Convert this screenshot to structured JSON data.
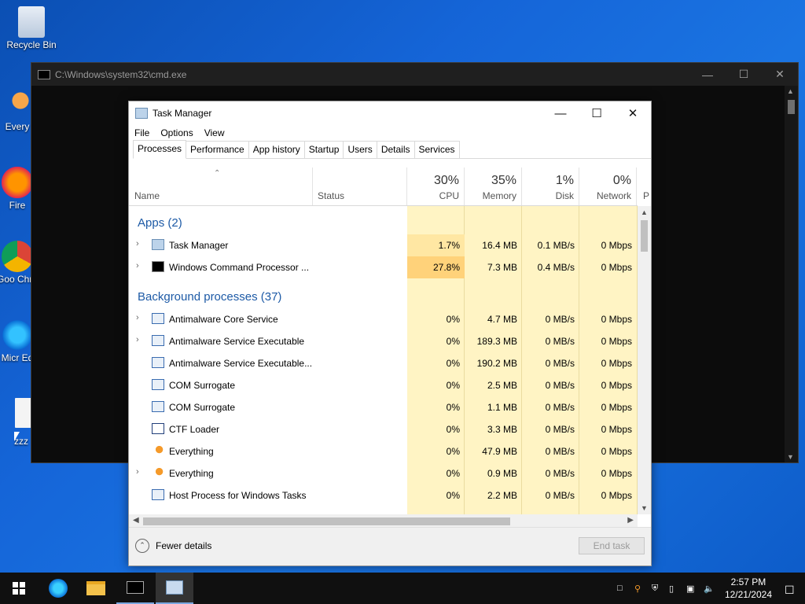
{
  "desktop": {
    "icons": [
      {
        "label": "Recycle Bin"
      },
      {
        "label": "Every"
      },
      {
        "label": "Fire"
      },
      {
        "label": "Goo Chro"
      },
      {
        "label": "Micr Ed"
      },
      {
        "label": "zzz"
      }
    ]
  },
  "cmd": {
    "title": "C:\\Windows\\system32\\cmd.exe"
  },
  "taskmanager": {
    "title": "Task Manager",
    "menu": [
      "File",
      "Options",
      "View"
    ],
    "tabs": [
      "Processes",
      "Performance",
      "App history",
      "Startup",
      "Users",
      "Details",
      "Services"
    ],
    "active_tab": "Processes",
    "columns": {
      "name": "Name",
      "status": "Status",
      "cpu": {
        "label": "CPU",
        "pct": "30%"
      },
      "memory": {
        "label": "Memory",
        "pct": "35%"
      },
      "disk": {
        "label": "Disk",
        "pct": "1%"
      },
      "network": {
        "label": "Network",
        "pct": "0%"
      },
      "extra": "P"
    },
    "groups": {
      "apps": "Apps (2)",
      "background": "Background processes (37)"
    },
    "apps": [
      {
        "name": "Task Manager",
        "cpu": "1.7%",
        "mem": "16.4 MB",
        "disk": "0.1 MB/s",
        "net": "0 Mbps",
        "expand": true,
        "icon": "taskmanager-icon"
      },
      {
        "name": "Windows Command Processor ...",
        "cpu": "27.8%",
        "mem": "7.3 MB",
        "disk": "0.4 MB/s",
        "net": "0 Mbps",
        "expand": true,
        "icon": "cmd-icon"
      }
    ],
    "background": [
      {
        "name": "Antimalware Core Service",
        "cpu": "0%",
        "mem": "4.7 MB",
        "disk": "0 MB/s",
        "net": "0 Mbps",
        "expand": true,
        "icon": "service-icon"
      },
      {
        "name": "Antimalware Service Executable",
        "cpu": "0%",
        "mem": "189.3 MB",
        "disk": "0 MB/s",
        "net": "0 Mbps",
        "expand": true,
        "icon": "service-icon"
      },
      {
        "name": "Antimalware Service Executable...",
        "cpu": "0%",
        "mem": "190.2 MB",
        "disk": "0 MB/s",
        "net": "0 Mbps",
        "expand": false,
        "icon": "service-icon"
      },
      {
        "name": "COM Surrogate",
        "cpu": "0%",
        "mem": "2.5 MB",
        "disk": "0 MB/s",
        "net": "0 Mbps",
        "expand": false,
        "icon": "service-icon"
      },
      {
        "name": "COM Surrogate",
        "cpu": "0%",
        "mem": "1.1 MB",
        "disk": "0 MB/s",
        "net": "0 Mbps",
        "expand": false,
        "icon": "service-icon"
      },
      {
        "name": "CTF Loader",
        "cpu": "0%",
        "mem": "3.3 MB",
        "disk": "0 MB/s",
        "net": "0 Mbps",
        "expand": false,
        "icon": "ctf-icon"
      },
      {
        "name": "Everything",
        "cpu": "0%",
        "mem": "47.9 MB",
        "disk": "0 MB/s",
        "net": "0 Mbps",
        "expand": false,
        "icon": "magnifier-icon"
      },
      {
        "name": "Everything",
        "cpu": "0%",
        "mem": "0.9 MB",
        "disk": "0 MB/s",
        "net": "0 Mbps",
        "expand": true,
        "icon": "magnifier-icon"
      },
      {
        "name": "Host Process for Windows Tasks",
        "cpu": "0%",
        "mem": "2.2 MB",
        "disk": "0 MB/s",
        "net": "0 Mbps",
        "expand": false,
        "icon": "service-icon"
      }
    ],
    "footer": {
      "fewer": "Fewer details",
      "end_task": "End task"
    }
  },
  "taskbar": {
    "time": "2:57 PM",
    "date": "12/21/2024"
  }
}
